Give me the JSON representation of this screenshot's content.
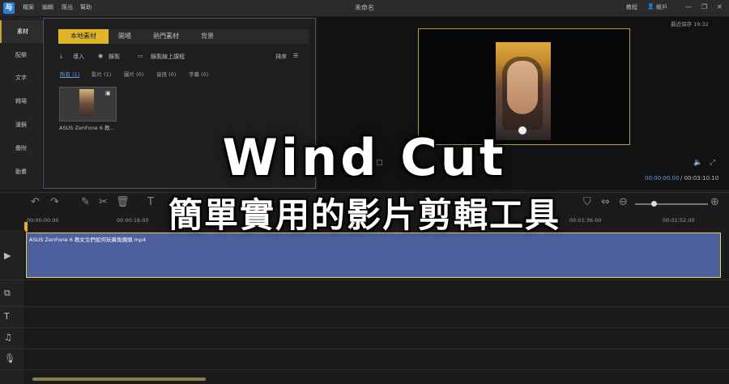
{
  "titlebar": {
    "logo": "与",
    "menu": [
      "檔案",
      "編輯",
      "匯出",
      "幫助"
    ],
    "doc_title": "未命名",
    "right_links": [
      "教程",
      "帳戶"
    ]
  },
  "sidebar": {
    "items": [
      {
        "label": "素材",
        "active": true
      },
      {
        "label": "配樂"
      },
      {
        "label": "文字"
      },
      {
        "label": "轉場"
      },
      {
        "label": "濾鏡"
      },
      {
        "label": "疊附"
      },
      {
        "label": "動畫"
      }
    ]
  },
  "media": {
    "tabs": [
      "本地素材",
      "開場",
      "熱門素材",
      "背景"
    ],
    "tools": {
      "import": "導入",
      "record": "錄製",
      "screen_record": "錄製線上課程",
      "sort": "排序"
    },
    "filters": [
      "所有 (1)",
      "影片 (1)",
      "圖片 (0)",
      "音訊 (0)",
      "字幕 (0)"
    ],
    "thumb_label": "ASUS ZenFone 6 教..."
  },
  "preview": {
    "autosave": "最近保存 19:32",
    "time_current": "00:00:00.00",
    "time_total": "/ 00:03:10.10"
  },
  "timeline": {
    "ruler": [
      "00:00:00.00",
      "00:00:16.00",
      "00:01:36.00",
      "00:01:52.00"
    ],
    "clip_label": "ASUS ZenFone 6 教女生們如何玩廣角鏡頭.mp4"
  },
  "overlay": {
    "title": "Wind Cut",
    "subtitle": "簡單實用的影片剪輯工具"
  },
  "colors": {
    "accent": "#e0b52a",
    "clip": "#4d5f9c",
    "link": "#5ea3e8"
  }
}
